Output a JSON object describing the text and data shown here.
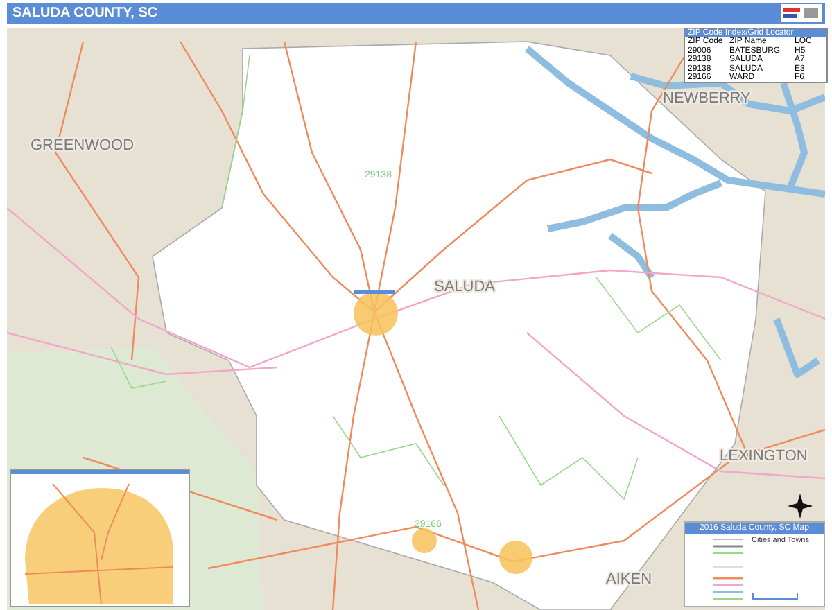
{
  "title": "SALUDA COUNTY, SC",
  "map": {
    "county_labels": [
      "GREENWOOD",
      "NEWBERRY",
      "SALUDA",
      "LEXINGTON",
      "AIKEN"
    ],
    "zip_labels": [
      "29138",
      "29166"
    ]
  },
  "zip_table": {
    "title": "ZIP Code Index/Grid Locator",
    "columns": [
      "ZIP Code",
      "ZIP Name",
      "LOC"
    ],
    "rows": [
      [
        "29006",
        "BATESBURG",
        "H5"
      ],
      [
        "29138",
        "SALUDA",
        "A7"
      ],
      [
        "29138",
        "SALUDA",
        "E3"
      ],
      [
        "29166",
        "WARD",
        "F6"
      ]
    ]
  },
  "legend": {
    "title": "2016 Saluda County, SC Map",
    "section": "Cities and Towns"
  }
}
